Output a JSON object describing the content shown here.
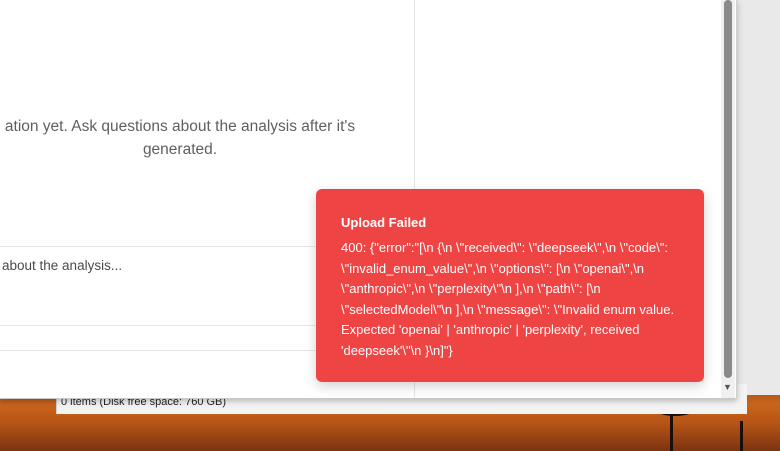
{
  "chat": {
    "empty_state_text": "ation yet. Ask questions about the analysis after it's generated.",
    "input_placeholder": "about the analysis..."
  },
  "toast": {
    "title": "Upload Failed",
    "message": "400: {\"error\":\"[\\n {\\n \\\"received\\\": \\\"deepseek\\\",\\n \\\"code\\\": \\\"invalid_enum_value\\\",\\n \\\"options\\\": [\\n \\\"openai\\\",\\n \\\"anthropic\\\",\\n \\\"perplexity\\\"\\n ],\\n \\\"path\\\": [\\n \\\"selectedModel\\\"\\n ],\\n \\\"message\\\": \\\"Invalid enum value. Expected 'openai' | 'anthropic' | 'perplexity', received 'deepseek'\\\"\\n }\\n]\"}",
    "color": "#ef4444"
  },
  "explorer": {
    "status_text": "0 items (Disk free space: 760 GB)"
  }
}
